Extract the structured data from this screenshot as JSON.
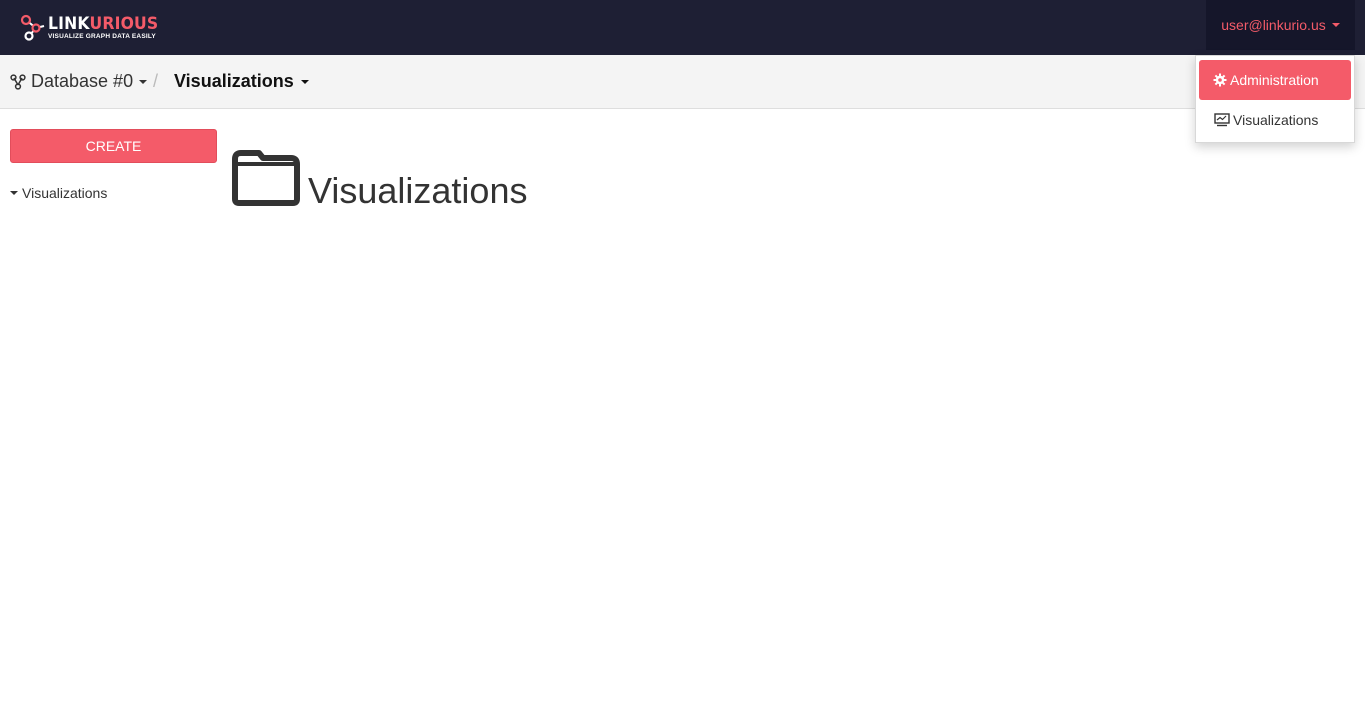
{
  "brand": {
    "name_part1": "LINK",
    "name_part2": "URIOUS",
    "tagline": "VISUALIZE GRAPH DATA EASILY",
    "accent_color": "#f45b69"
  },
  "user_menu": {
    "label": "user@linkurio.us",
    "items": [
      {
        "label": "Administration",
        "icon": "gear-icon",
        "active": true
      },
      {
        "label": "Visualizations",
        "icon": "monitor-chart-icon",
        "active": false
      }
    ]
  },
  "breadcrumb": {
    "database": "Database #0",
    "database_icon": "graph-nodes-icon",
    "separator": "/",
    "current": "Visualizations"
  },
  "sidebar": {
    "create_label": "CREATE",
    "tree_item": "Visualizations"
  },
  "main": {
    "title": "Visualizations",
    "title_icon": "folder-icon"
  }
}
